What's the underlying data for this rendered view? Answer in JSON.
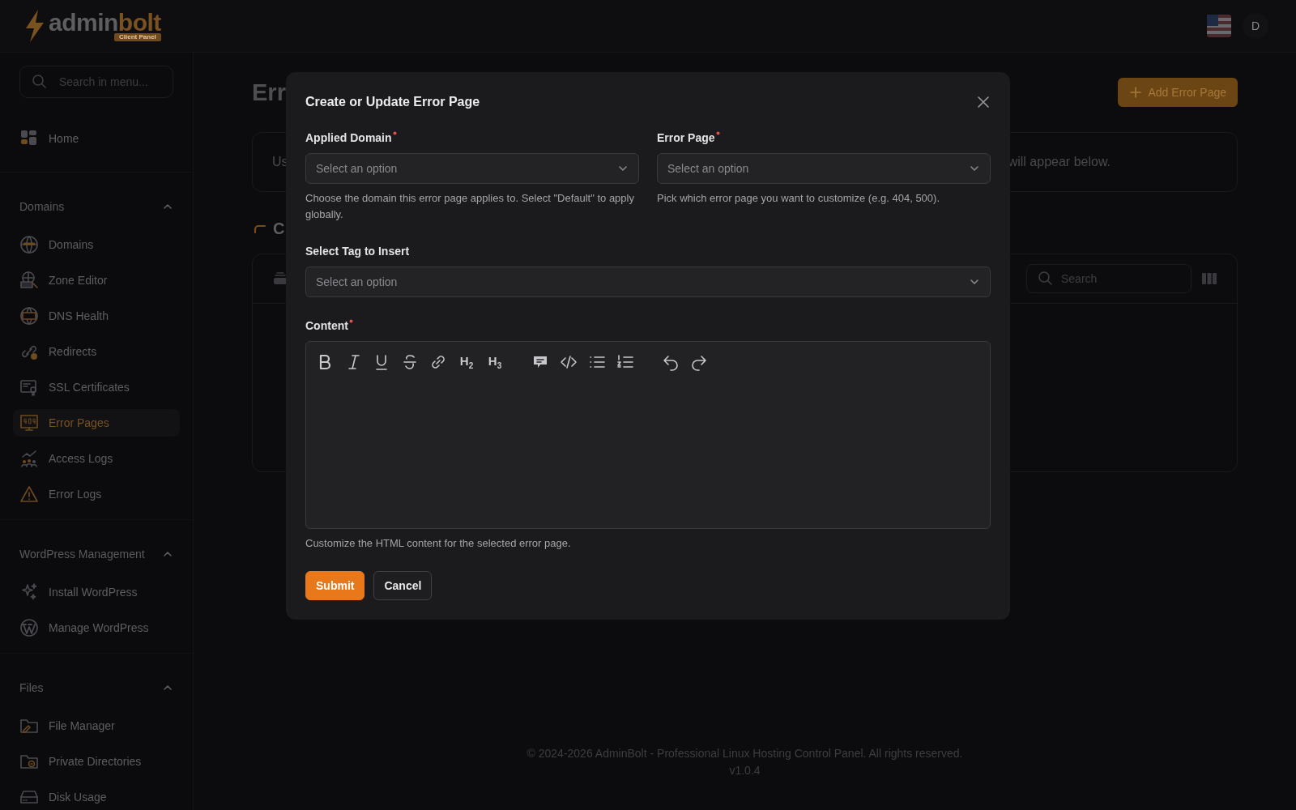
{
  "header": {
    "logo": {
      "parts": [
        "admin",
        "bolt"
      ],
      "badge": "Client Panel"
    },
    "avatar": "D"
  },
  "sidebar": {
    "search": {
      "placeholder": "Search in menu..."
    },
    "top_items": [
      {
        "label": "Home",
        "selected": false
      }
    ],
    "sections": [
      {
        "title": "Domains",
        "expanded": true,
        "items": [
          {
            "label": "Domains",
            "selected": false
          },
          {
            "label": "Zone Editor",
            "selected": false
          },
          {
            "label": "DNS Health",
            "selected": false
          },
          {
            "label": "Redirects",
            "selected": false
          },
          {
            "label": "SSL Certificates",
            "selected": false
          },
          {
            "label": "Error Pages",
            "selected": true
          },
          {
            "label": "Access Logs",
            "selected": false
          },
          {
            "label": "Error Logs",
            "selected": false
          }
        ]
      },
      {
        "title": "WordPress Management",
        "expanded": true,
        "items": [
          {
            "label": "Install WordPress",
            "selected": false
          },
          {
            "label": "Manage WordPress",
            "selected": false
          }
        ]
      },
      {
        "title": "Files",
        "expanded": true,
        "items": [
          {
            "label": "File Manager",
            "selected": false
          },
          {
            "label": "Private Directories",
            "selected": false
          },
          {
            "label": "Disk Usage",
            "selected": false
          }
        ]
      }
    ]
  },
  "page": {
    "title": "Err",
    "add_button": "Add Error Page",
    "info_left": "Us",
    "info_right": "will appear below.",
    "section_heading": "C",
    "table": {
      "search": {
        "placeholder": "Search"
      }
    }
  },
  "modal": {
    "title": "Create or Update Error Page",
    "fields": [
      {
        "label": "Applied Domain",
        "required": true,
        "placeholder": "Select an option",
        "help": "Choose the domain this error page applies to. Select \"Default\" to apply globally."
      },
      {
        "label": "Error Page",
        "required": true,
        "placeholder": "Select an option",
        "help": "Pick which error page you want to customize (e.g. 404, 500)."
      },
      {
        "label": "Select Tag to Insert",
        "required": false,
        "placeholder": "Select an option"
      }
    ],
    "editor": {
      "label": "Content",
      "required": true,
      "toolbar_labels": [
        "H$_{2}$",
        "H$_{3}$"
      ],
      "help": "Customize the HTML content for the selected error page."
    },
    "buttons": [
      {
        "label": "Submit",
        "kind": "primary"
      },
      {
        "label": "Cancel",
        "kind": "secondary"
      }
    ]
  },
  "footer": {
    "copyright": "© 2024-2026 AdminBolt - Professional Linux Hosting Control Panel. All rights reserved.",
    "version": "v1.0.4"
  }
}
